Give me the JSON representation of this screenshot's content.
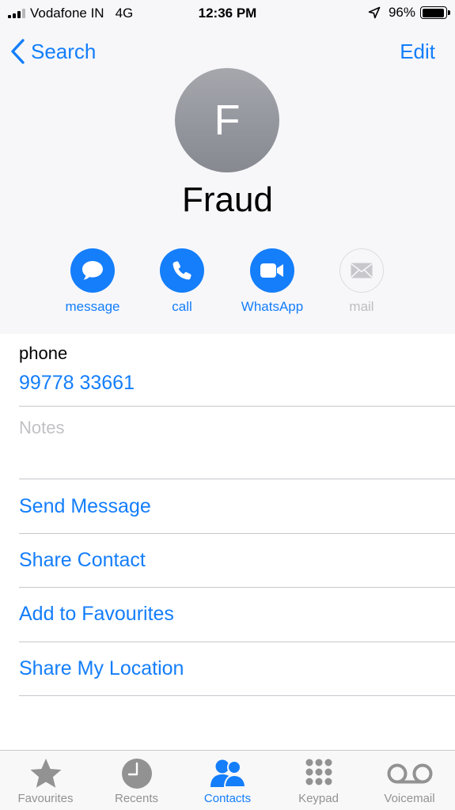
{
  "status_bar": {
    "carrier": "Vodafone IN",
    "network": "4G",
    "time": "12:36 PM",
    "battery_percent": "96%",
    "battery_level": 0.96,
    "signal_bars_active": 3,
    "signal_bars_total": 4
  },
  "nav": {
    "back_label": "Search",
    "edit_label": "Edit"
  },
  "contact": {
    "initial": "F",
    "name": "Fraud"
  },
  "actions": [
    {
      "label": "message",
      "icon": "message-icon",
      "enabled": true
    },
    {
      "label": "call",
      "icon": "phone-icon",
      "enabled": true
    },
    {
      "label": "WhatsApp",
      "icon": "video-icon",
      "enabled": true
    },
    {
      "label": "mail",
      "icon": "mail-icon",
      "enabled": false
    }
  ],
  "phone": {
    "label": "phone",
    "number": "99778 33661"
  },
  "notes": {
    "placeholder": "Notes"
  },
  "options": [
    "Send Message",
    "Share Contact",
    "Add to Favourites",
    "Share My Location"
  ],
  "tabs": [
    {
      "label": "Favourites",
      "icon": "star-icon",
      "active": false
    },
    {
      "label": "Recents",
      "icon": "clock-icon",
      "active": false
    },
    {
      "label": "Contacts",
      "icon": "contacts-icon",
      "active": true
    },
    {
      "label": "Keypad",
      "icon": "keypad-icon",
      "active": false
    },
    {
      "label": "Voicemail",
      "icon": "voicemail-icon",
      "active": false
    }
  ],
  "colors": {
    "accent": "#147efb",
    "header_background": "#f7f7fa",
    "separator": "#c8c7cc",
    "inactive_tab": "#929292",
    "placeholder": "#c1c1c6"
  }
}
